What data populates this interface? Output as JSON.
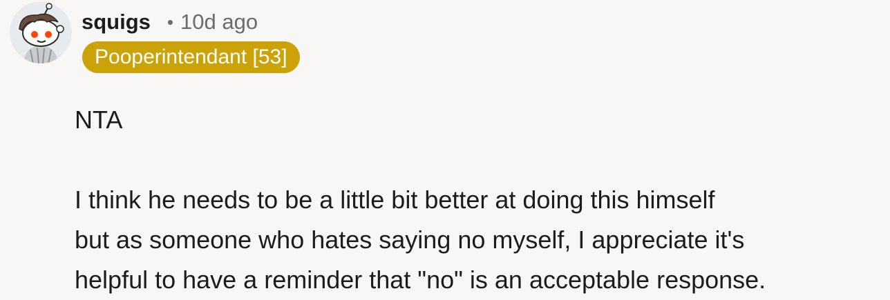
{
  "comment": {
    "avatar_icon": "snoo-avatar-icon",
    "username": "squigs",
    "separator": "•",
    "timestamp": "10d ago",
    "flair": "Pooperintendant [53]",
    "flair_color": "#cba309",
    "body": {
      "line1": "NTA",
      "paragraph2_line1": "I think he needs to be a little bit better at doing this himself",
      "paragraph2_line2": "but as someone who hates saying no myself, I appreciate it's",
      "paragraph2_line3": "helpful to have a reminder that \"no\" is an acceptable response."
    }
  }
}
